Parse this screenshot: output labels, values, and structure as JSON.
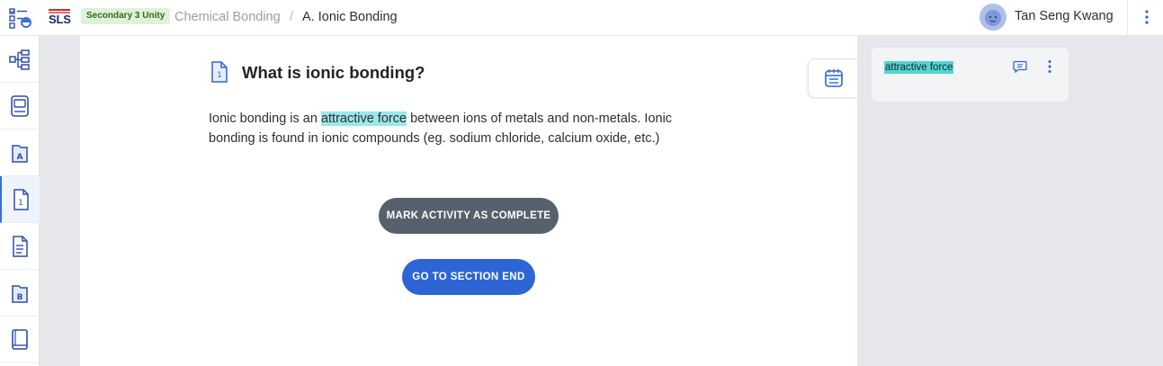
{
  "header": {
    "logo_text": "SLS",
    "course_badge": "Secondary 3 Unity",
    "breadcrumb": {
      "lesson": "Chemical Bonding",
      "separator": "/",
      "section": "A. Ionic Bonding"
    },
    "user_name": "Tan Seng Kwang"
  },
  "rail": {
    "items": [
      {
        "icon": "lesson-map-icon"
      },
      {
        "icon": "notebook-icon"
      },
      {
        "icon": "section-a-icon",
        "letter": "A"
      },
      {
        "icon": "activity-1-icon",
        "number": "1",
        "active": true
      },
      {
        "icon": "worksheet-icon"
      },
      {
        "icon": "section-b-icon",
        "letter": "B"
      },
      {
        "icon": "book-icon"
      }
    ]
  },
  "activity": {
    "number": "1",
    "title": "What is ionic bonding?",
    "text_before": "Ionic bonding is an ",
    "text_highlight": "attractive force",
    "text_after": " between ions of metals and non-metals. Ionic bonding is found in ionic compounds (eg. sodium chloride, calcium oxide, etc.)",
    "mark_complete_label": "MARK ACTIVITY AS COMPLETE",
    "go_to_end_label": "GO TO SECTION END"
  },
  "notes_panel": {
    "annotation_text": "attractive force"
  },
  "colors": {
    "accent": "#2d66d4",
    "highlight": "#9ce7e8",
    "annotation_highlight": "#4fd6d3",
    "badge_bg": "#dff1d8",
    "complete_button": "#58606d"
  }
}
